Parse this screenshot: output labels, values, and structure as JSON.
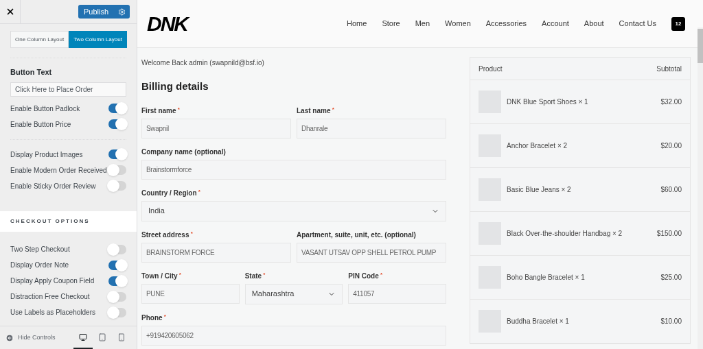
{
  "sidebar": {
    "publish_button": "Publish",
    "layout_options": [
      {
        "label": "One Column Layout",
        "selected": false
      },
      {
        "label": "Two Column Layout",
        "selected": true
      }
    ],
    "button_text": {
      "label": "Button Text",
      "value": "Click Here to Place Order"
    },
    "toggle_groups": [
      [
        {
          "label": "Enable Button Padlock",
          "on": true
        },
        {
          "label": "Enable Button Price",
          "on": true
        }
      ],
      [
        {
          "label": "Display Product Images",
          "on": true
        },
        {
          "label": "Enable Modern Order Received",
          "on": false
        },
        {
          "label": "Enable Sticky Order Review",
          "on": false
        }
      ]
    ],
    "section_title": "CHECKOUT OPTIONS",
    "checkout_options": [
      {
        "label": "Two Step Checkout",
        "on": false
      },
      {
        "label": "Display Order Note",
        "on": true
      },
      {
        "label": "Display Apply Coupon Field",
        "on": true
      },
      {
        "label": "Distraction Free Checkout",
        "on": false
      },
      {
        "label": "Use Labels as Placeholders",
        "on": false
      }
    ],
    "hide_controls": "Hide Controls",
    "devices": [
      {
        "kind": "desktop",
        "selected": true
      },
      {
        "kind": "tablet",
        "selected": false
      },
      {
        "kind": "mobile",
        "selected": false
      }
    ]
  },
  "site": {
    "logo": "DNK",
    "nav": [
      "Home",
      "Store",
      "Men",
      "Women",
      "Accessories",
      "Account",
      "About",
      "Contact Us"
    ],
    "cart_count": "12"
  },
  "welcome": "Welcome Back admin (swapnild@bsf.io)",
  "billing_title": "Billing details",
  "field_rows": [
    [
      {
        "label": "First name",
        "required_mark": "*",
        "kind": "input",
        "value": "Swapnil"
      },
      {
        "label": "Last name",
        "required_mark": "*",
        "kind": "input",
        "value": "Dhanrale"
      }
    ],
    [
      {
        "label": "Company name (optional)",
        "kind": "input",
        "value": "Brainstormforce"
      }
    ],
    [
      {
        "label": "Country / Region",
        "required_mark": "*",
        "kind": "select",
        "value": "India"
      }
    ],
    [
      {
        "label": "Street address",
        "required_mark": "*",
        "kind": "input",
        "value": "BRAINSTORM FORCE"
      },
      {
        "label": "Apartment, suite, unit, etc. (optional)",
        "kind": "input",
        "value": "VASANT UTSAV OPP SHELL PETROL PUMP"
      }
    ],
    [
      {
        "label": "Town / City",
        "required_mark": "*",
        "kind": "input",
        "value": "PUNE"
      },
      {
        "label": "State",
        "required_mark": "*",
        "kind": "select",
        "value": "Maharashtra"
      },
      {
        "label": "PIN Code",
        "required_mark": "*",
        "kind": "input",
        "value": "411057"
      }
    ],
    [
      {
        "label": "Phone",
        "required_mark": "*",
        "kind": "input",
        "value": "+919420605062"
      }
    ]
  ],
  "order": {
    "columns": [
      "Product",
      "Subtotal"
    ],
    "items": [
      {
        "name": "DNK Blue Sport Shoes × 1",
        "subtotal": "$32.00"
      },
      {
        "name": "Anchor Bracelet × 2",
        "subtotal": "$20.00"
      },
      {
        "name": "Basic Blue Jeans × 2",
        "subtotal": "$60.00"
      },
      {
        "name": "Black Over-the-shoulder Handbag × 2",
        "subtotal": "$150.00"
      },
      {
        "name": "Boho Bangle Bracelet × 1",
        "subtotal": "$25.00"
      },
      {
        "name": "Buddha Bracelet × 1",
        "subtotal": "$10.00"
      }
    ]
  }
}
